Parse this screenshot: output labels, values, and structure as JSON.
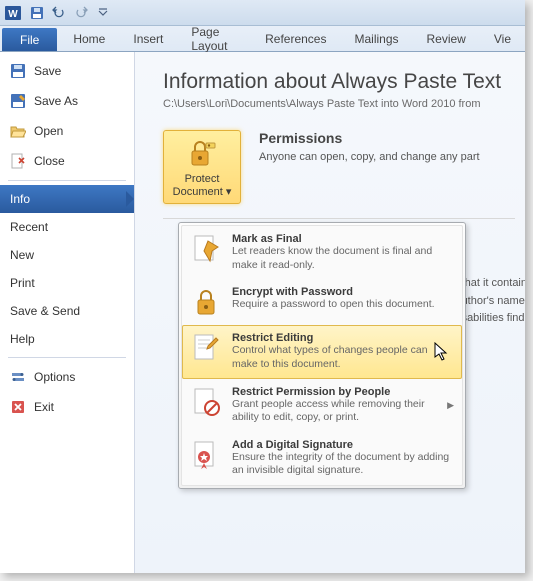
{
  "qat": {
    "save": "save",
    "undo": "undo",
    "redo": "redo"
  },
  "tabs": {
    "file": "File",
    "home": "Home",
    "insert": "Insert",
    "page_layout": "Page Layout",
    "references": "References",
    "mailings": "Mailings",
    "review": "Review",
    "view": "Vie"
  },
  "sidebar": {
    "save": "Save",
    "save_as": "Save As",
    "open": "Open",
    "close": "Close",
    "info": "Info",
    "recent": "Recent",
    "new": "New",
    "print": "Print",
    "save_send": "Save & Send",
    "help": "Help",
    "options": "Options",
    "exit": "Exit"
  },
  "content": {
    "heading": "Information about Always Paste Text",
    "path": "C:\\Users\\Lori\\Documents\\Always Paste Text into Word 2010 from"
  },
  "permissions": {
    "button": "Protect Document",
    "title": "Permissions",
    "text": "Anyone can open, copy, and change any part"
  },
  "bgtext": {
    "l1": "that it contain",
    "l2": "uthor's name",
    "l3": "sabilities find"
  },
  "menu": {
    "mark_final": {
      "title": "Mark as Final",
      "desc": "Let readers know the document is final and make it read-only."
    },
    "encrypt": {
      "title": "Encrypt with Password",
      "desc": "Require a password to open this document."
    },
    "restrict_editing": {
      "title": "Restrict Editing",
      "desc": "Control what types of changes people can make to this document."
    },
    "restrict_people": {
      "title": "Restrict Permission by People",
      "desc": "Grant people access while removing their ability to edit, copy, or print."
    },
    "signature": {
      "title": "Add a Digital Signature",
      "desc": "Ensure the integrity of the document by adding an invisible digital signature."
    }
  }
}
